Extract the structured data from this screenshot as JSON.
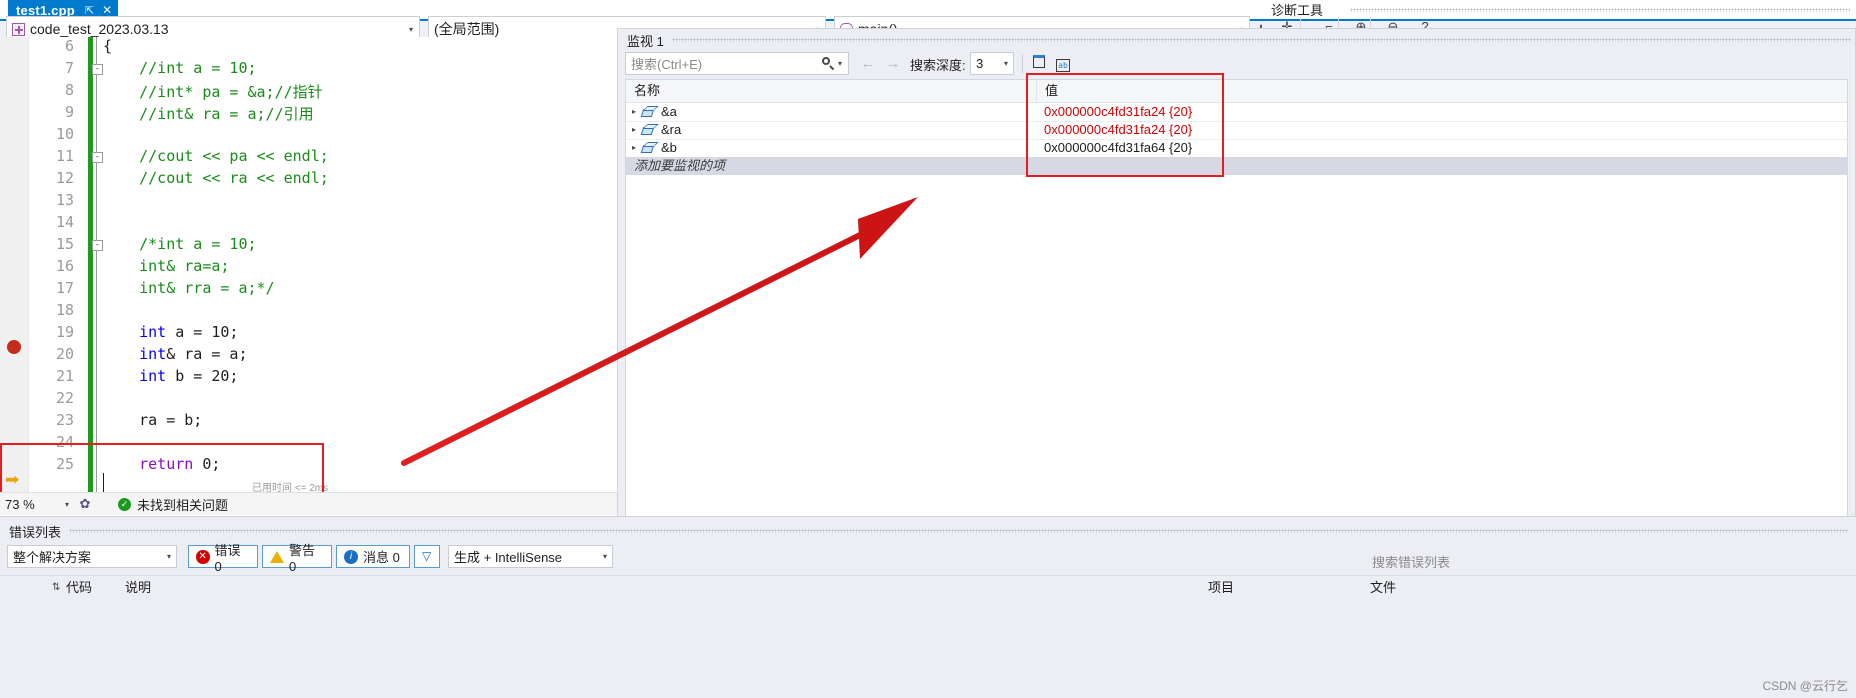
{
  "tab": {
    "title": "test1.cpp",
    "pin_glyph": "⇱",
    "close_glyph": "✕"
  },
  "navbar": {
    "project": "code_test_2023.03.13",
    "scope": "(全局范围)",
    "member": "main()",
    "dropdown_arrow": "▾",
    "splitter_glyph": "✛"
  },
  "diagnostics": {
    "label": "诊断工具",
    "buttons": [
      "✛",
      "✿",
      "⌐",
      "⊕",
      "⊖",
      "?"
    ]
  },
  "editor": {
    "zoom": "73 %",
    "zoom_arrow": "▾",
    "issue_icon": "✿",
    "issue_ok_glyph": "✓",
    "issue_text": "未找到相关问题",
    "elapsed": "已用时间 <= 2ms",
    "breakpoint_line": 19,
    "current_line": 25,
    "lines": [
      {
        "num": "6",
        "fold": "",
        "tokens": [
          {
            "t": "{",
            "c": "c-punct"
          }
        ]
      },
      {
        "num": "7",
        "fold": "-",
        "tokens": [
          {
            "t": "    //int a = 10;",
            "c": "c-comment"
          }
        ]
      },
      {
        "num": "8",
        "fold": "",
        "tokens": [
          {
            "t": "    //int* pa = &a;//指针",
            "c": "c-comment"
          }
        ]
      },
      {
        "num": "9",
        "fold": "",
        "tokens": [
          {
            "t": "    //int& ra = a;//引用",
            "c": "c-comment"
          }
        ]
      },
      {
        "num": "10",
        "fold": "",
        "tokens": []
      },
      {
        "num": "11",
        "fold": "-",
        "tokens": [
          {
            "t": "    //cout << pa << endl;",
            "c": "c-comment"
          }
        ]
      },
      {
        "num": "12",
        "fold": "",
        "tokens": [
          {
            "t": "    //cout << ra << endl;",
            "c": "c-comment"
          }
        ]
      },
      {
        "num": "13",
        "fold": "",
        "tokens": []
      },
      {
        "num": "14",
        "fold": "",
        "tokens": []
      },
      {
        "num": "15",
        "fold": "-",
        "tokens": [
          {
            "t": "    /*int a = 10;",
            "c": "c-comment"
          }
        ]
      },
      {
        "num": "16",
        "fold": "",
        "tokens": [
          {
            "t": "    int& ra=a;",
            "c": "c-comment"
          }
        ]
      },
      {
        "num": "17",
        "fold": "",
        "tokens": [
          {
            "t": "    int& rra = a;*/",
            "c": "c-comment"
          }
        ]
      },
      {
        "num": "18",
        "fold": "",
        "tokens": []
      },
      {
        "num": "19",
        "fold": "",
        "tokens": [
          {
            "t": "    int",
            "c": "c-key"
          },
          {
            "t": " a = 10;",
            "c": "c-punct"
          }
        ]
      },
      {
        "num": "20",
        "fold": "",
        "tokens": [
          {
            "t": "    int",
            "c": "c-key"
          },
          {
            "t": "& ra = a;",
            "c": "c-punct"
          }
        ]
      },
      {
        "num": "21",
        "fold": "",
        "tokens": [
          {
            "t": "    int",
            "c": "c-key"
          },
          {
            "t": " b = 20;",
            "c": "c-punct"
          }
        ]
      },
      {
        "num": "22",
        "fold": "",
        "tokens": []
      },
      {
        "num": "23",
        "fold": "",
        "tokens": [
          {
            "t": "    ra = b;",
            "c": "c-punct"
          }
        ]
      },
      {
        "num": "24",
        "fold": "",
        "tokens": []
      },
      {
        "num": "25",
        "fold": "",
        "tokens": [
          {
            "t": "    return",
            "c": "c-ctrl"
          },
          {
            "t": " 0;",
            "c": "c-punct"
          }
        ]
      }
    ]
  },
  "watch": {
    "title": "监视 1",
    "search_placeholder": "搜索(Ctrl+E)",
    "search_dropdown_arrow": "▾",
    "nav_prev": "←",
    "nav_next": "→",
    "depth_label": "搜索深度:",
    "depth_value": "3",
    "depth_arrow": "▾",
    "toolbar_icons": [
      "pin-icon",
      "hex-display-icon"
    ],
    "columns": {
      "name": "名称",
      "value": "值"
    },
    "rows": [
      {
        "expander": "▸",
        "name": "&a",
        "value": "0x000000c4fd31fa24 {20}",
        "value_color": "val-red"
      },
      {
        "expander": "▸",
        "name": "&ra",
        "value": "0x000000c4fd31fa24 {20}",
        "value_color": "val-red"
      },
      {
        "expander": "▸",
        "name": "&b",
        "value": "0x000000c4fd31fa64 {20}",
        "value_color": "val-black"
      }
    ],
    "add_item_placeholder": "添加要监视的项"
  },
  "error_list": {
    "title": "错误列表",
    "scope": "整个解决方案",
    "scope_arrow": "▾",
    "errors_label": "错误 0",
    "warnings_label": "警告 0",
    "messages_label": "消息 0",
    "error_badge": "✕",
    "info_badge": "i",
    "filter_glyph": "▽",
    "build_filter": "生成 + IntelliSense",
    "build_arrow": "▾",
    "search_placeholder": "搜索错误列表",
    "columns": {
      "sort": "⇅",
      "code": "代码",
      "description": "说明",
      "project": "项目",
      "file": "文件"
    },
    "watermark": "CSDN @云行乞"
  },
  "colors": {
    "accent_blue": "#007acc",
    "annotation_red": "#e02020",
    "value_red": "#d40000",
    "comment_green": "#198c19",
    "keyword_blue": "#0000ff",
    "keyword_purple": "#8f08c4",
    "changebar_green": "#1d9b1d",
    "breakpoint_red": "#c42b1c"
  }
}
